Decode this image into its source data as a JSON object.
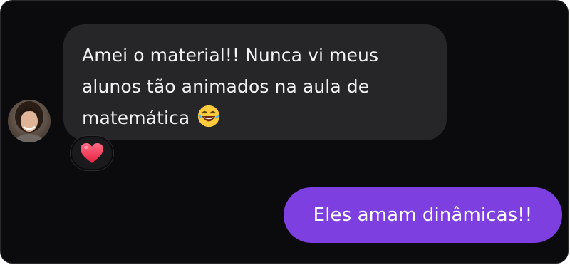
{
  "conversation": {
    "incoming_message": {
      "lines": [
        "Amei o material!! Nunca vi meus",
        "alunos tão animados na aula de",
        "matemática"
      ],
      "emoji": "face-with-tears-of-joy-icon",
      "reaction": "heart-icon"
    },
    "outgoing_message": {
      "text": "Eles amam dinâmicas!!"
    }
  },
  "colors": {
    "background": "#0b0b0e",
    "incoming_bubble": "#262629",
    "outgoing_bubble": "#7d3fe0",
    "reaction_heart": "#f03a5f"
  }
}
